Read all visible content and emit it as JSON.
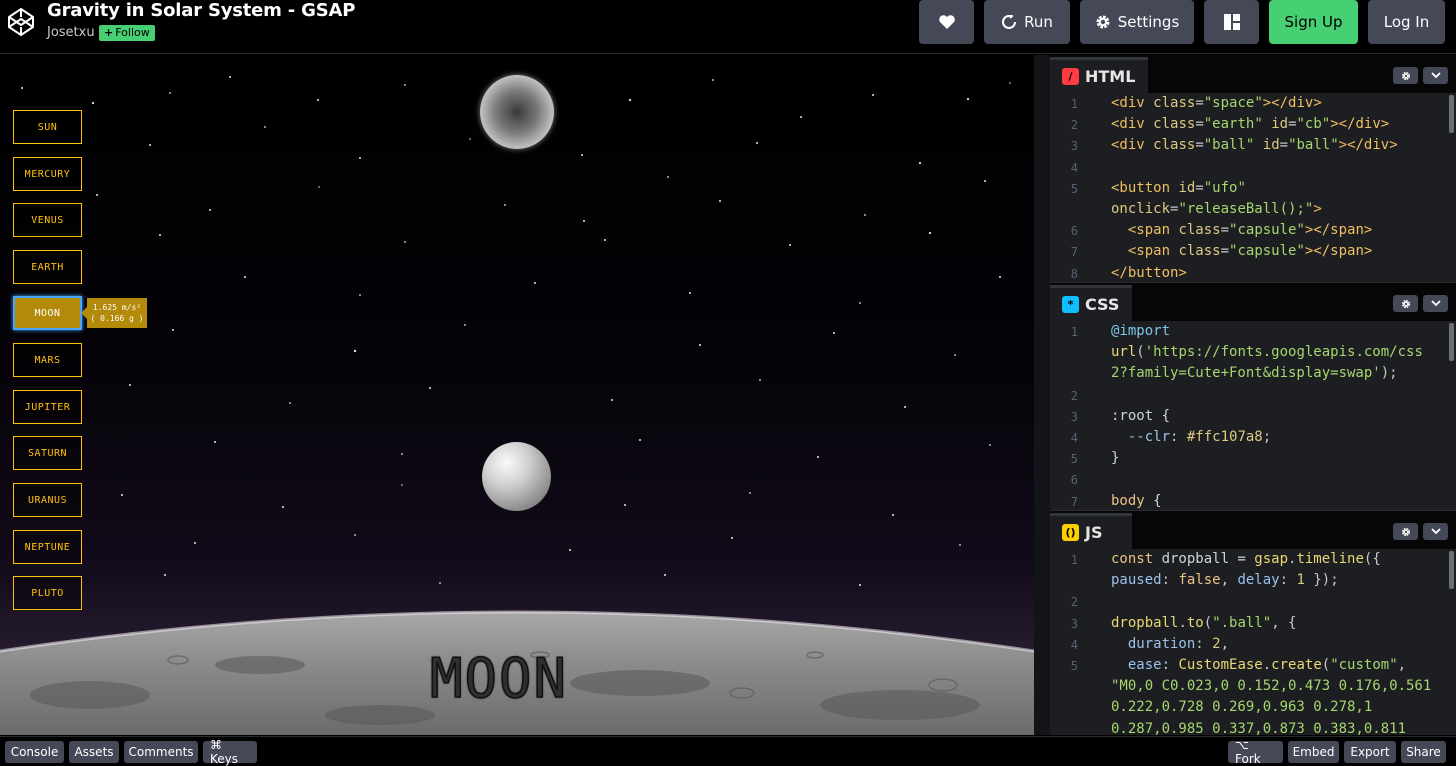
{
  "header": {
    "title": "Gravity in Solar System - GSAP",
    "author": "Josetxu",
    "follow_label": "Follow",
    "buttons": {
      "like_icon": "heart-icon",
      "run_label": "Run",
      "settings_label": "Settings",
      "layout_icon": "layout-icon",
      "signup_label": "Sign Up",
      "login_label": "Log In"
    }
  },
  "preview": {
    "planets": [
      "SUN",
      "MERCURY",
      "VENUS",
      "EARTH",
      "MOON",
      "MARS",
      "JUPITER",
      "SATURN",
      "URANUS",
      "NEPTUNE",
      "PLUTO"
    ],
    "active_planet": "MOON",
    "tooltip_line1": "1.625 m/s²",
    "tooltip_line2": "( 0.166 g )",
    "surface_label": "MOON"
  },
  "editors": {
    "html": {
      "title": "HTML",
      "lines": [
        {
          "n": "1",
          "tokens": [
            [
              "tag",
              "<div "
            ],
            [
              "attr",
              "class"
            ],
            [
              "pun",
              "="
            ],
            [
              "str",
              "\"space\""
            ],
            [
              "tag",
              "></div>"
            ]
          ]
        },
        {
          "n": "2",
          "tokens": [
            [
              "tag",
              "<div "
            ],
            [
              "attr",
              "class"
            ],
            [
              "pun",
              "="
            ],
            [
              "str",
              "\"earth\""
            ],
            [
              "tag",
              " "
            ],
            [
              "attr",
              "id"
            ],
            [
              "pun",
              "="
            ],
            [
              "str",
              "\"cb\""
            ],
            [
              "tag",
              "></div>"
            ]
          ]
        },
        {
          "n": "3",
          "tokens": [
            [
              "tag",
              "<div "
            ],
            [
              "attr",
              "class"
            ],
            [
              "pun",
              "="
            ],
            [
              "str",
              "\"ball\""
            ],
            [
              "tag",
              " "
            ],
            [
              "attr",
              "id"
            ],
            [
              "pun",
              "="
            ],
            [
              "str",
              "\"ball\""
            ],
            [
              "tag",
              "></div>"
            ]
          ]
        },
        {
          "n": "4",
          "tokens": []
        },
        {
          "n": "5",
          "tokens": [
            [
              "tag",
              "<button "
            ],
            [
              "attr",
              "id"
            ],
            [
              "pun",
              "="
            ],
            [
              "str",
              "\"ufo\""
            ]
          ]
        },
        {
          "n": "",
          "tokens": [
            [
              "attr",
              "onclick"
            ],
            [
              "pun",
              "="
            ],
            [
              "str",
              "\"releaseBall();\""
            ],
            [
              "tag",
              ">"
            ]
          ]
        },
        {
          "n": "6",
          "tokens": [
            [
              "plain",
              "  "
            ],
            [
              "tag",
              "<span "
            ],
            [
              "attr",
              "class"
            ],
            [
              "pun",
              "="
            ],
            [
              "str",
              "\"capsule\""
            ],
            [
              "tag",
              "></span>"
            ]
          ]
        },
        {
          "n": "7",
          "tokens": [
            [
              "plain",
              "  "
            ],
            [
              "tag",
              "<span "
            ],
            [
              "attr",
              "class"
            ],
            [
              "pun",
              "="
            ],
            [
              "str",
              "\"capsule\""
            ],
            [
              "tag",
              "></span>"
            ]
          ]
        },
        {
          "n": "8",
          "tokens": [
            [
              "tag",
              "</button>"
            ]
          ]
        }
      ]
    },
    "css": {
      "title": "CSS",
      "lines": [
        {
          "n": "1",
          "tokens": [
            [
              "at",
              "@import"
            ]
          ]
        },
        {
          "n": "",
          "tokens": [
            [
              "fn",
              "url"
            ],
            [
              "pun",
              "("
            ],
            [
              "str",
              "'https://fonts.googleapis.com/css"
            ]
          ]
        },
        {
          "n": "",
          "tokens": [
            [
              "str",
              "2?family=Cute+Font&display=swap'"
            ],
            [
              "pun",
              ");"
            ]
          ]
        },
        {
          "n": "2",
          "tokens": []
        },
        {
          "n": "3",
          "tokens": [
            [
              "plain",
              ":root {"
            ]
          ]
        },
        {
          "n": "4",
          "tokens": [
            [
              "plain",
              "  "
            ],
            [
              "prop",
              "--clr"
            ],
            [
              "pun",
              ": "
            ],
            [
              "num",
              "#ffc107a8"
            ],
            [
              "pun",
              ";"
            ]
          ]
        },
        {
          "n": "5",
          "tokens": [
            [
              "plain",
              "}"
            ]
          ]
        },
        {
          "n": "6",
          "tokens": []
        },
        {
          "n": "7",
          "tokens": [
            [
              "kw",
              "body"
            ],
            [
              "plain",
              " {"
            ]
          ]
        }
      ]
    },
    "js": {
      "title": "JS",
      "lines": [
        {
          "n": "1",
          "tokens": [
            [
              "kw",
              "const "
            ],
            [
              "plain",
              "dropball = "
            ],
            [
              "fn",
              "gsap"
            ],
            [
              "pun",
              "."
            ],
            [
              "fn",
              "timeline"
            ],
            [
              "pun",
              "({"
            ]
          ]
        },
        {
          "n": "",
          "tokens": [
            [
              "prop",
              "paused"
            ],
            [
              "pun",
              ": "
            ],
            [
              "kw",
              "false"
            ],
            [
              "pun",
              ", "
            ],
            [
              "prop",
              "delay"
            ],
            [
              "pun",
              ": "
            ],
            [
              "num",
              "1"
            ],
            [
              "pun",
              " });"
            ]
          ]
        },
        {
          "n": "2",
          "tokens": []
        },
        {
          "n": "3",
          "tokens": [
            [
              "fn",
              "dropball"
            ],
            [
              "pun",
              "."
            ],
            [
              "fn",
              "to"
            ],
            [
              "pun",
              "("
            ],
            [
              "str",
              "\".ball\""
            ],
            [
              "pun",
              ", {"
            ]
          ]
        },
        {
          "n": "4",
          "tokens": [
            [
              "plain",
              "  "
            ],
            [
              "prop",
              "duration"
            ],
            [
              "pun",
              ": "
            ],
            [
              "num",
              "2"
            ],
            [
              "pun",
              ","
            ]
          ]
        },
        {
          "n": "5",
          "tokens": [
            [
              "plain",
              "  "
            ],
            [
              "prop",
              "ease"
            ],
            [
              "pun",
              ": "
            ],
            [
              "fn",
              "CustomEase"
            ],
            [
              "pun",
              "."
            ],
            [
              "fn",
              "create"
            ],
            [
              "pun",
              "("
            ],
            [
              "str",
              "\"custom\""
            ],
            [
              "pun",
              ","
            ]
          ]
        },
        {
          "n": "",
          "tokens": [
            [
              "str",
              "\"M0,0 C0.023,0 0.152,0.473 0.176,0.561"
            ]
          ]
        },
        {
          "n": "",
          "tokens": [
            [
              "str",
              "0.222,0.728 0.269,0.963 0.278,1"
            ]
          ]
        },
        {
          "n": "",
          "tokens": [
            [
              "str",
              "0.287,0.985 0.337,0.873 0.383,0.811"
            ]
          ]
        }
      ]
    }
  },
  "footer": {
    "console_label": "Console",
    "assets_label": "Assets",
    "comments_label": "Comments",
    "keys_label": "⌘ Keys",
    "fork_label": "⌥ Fork",
    "embed_label": "Embed",
    "export_label": "Export",
    "share_label": "Share"
  }
}
